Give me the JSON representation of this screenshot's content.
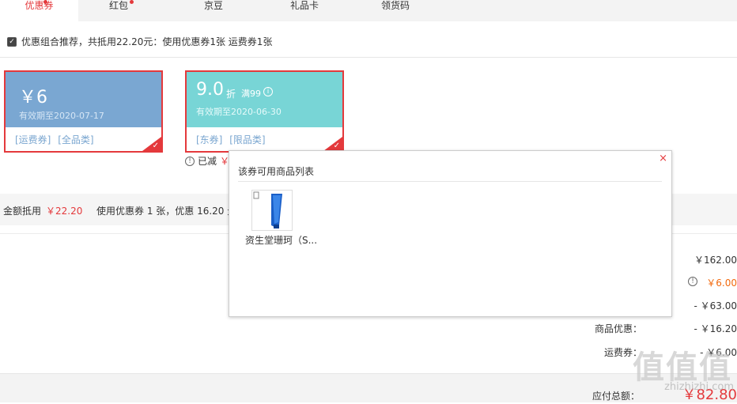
{
  "tabs": [
    {
      "label": "优惠券",
      "active": true,
      "dot": true
    },
    {
      "label": "红包",
      "active": false,
      "dot": true
    },
    {
      "label": "京豆",
      "active": false,
      "dot": false
    },
    {
      "label": "礼品卡",
      "active": false,
      "dot": false
    },
    {
      "label": "领货码",
      "active": false,
      "dot": false
    }
  ],
  "recommend": {
    "checked": true,
    "text": "优惠组合推荐，共抵用22.20元：使用优惠券1张 运费券1张"
  },
  "coupons": [
    {
      "amount": "￥6",
      "expiry": "有效期至2020-07-17",
      "tags": [
        "[运费券]",
        "[全品类]"
      ],
      "color": "#7aa7d2",
      "selected": true
    },
    {
      "amount": "9.0",
      "unit": "折",
      "condition": "满99",
      "expiry": "有效期至2020-06-30",
      "tags": [
        "[东券]",
        "[限品类]"
      ],
      "color": "#78d5d6",
      "selected": true
    }
  ],
  "reduced": {
    "label": "已减",
    "value": "￥"
  },
  "summary_band": {
    "deduct_label": "金额抵用",
    "deduct_value": "￥22.20",
    "usage_text": "使用优惠券 1 张，优惠 16.20 元"
  },
  "totals": [
    {
      "label": "",
      "value": "￥162.00"
    },
    {
      "label": "",
      "value": "￥6.00",
      "info": true
    },
    {
      "label": "",
      "value": "- ￥63.00"
    },
    {
      "label": "商品优惠：",
      "value": "- ￥16.20"
    },
    {
      "label": "运费券：",
      "value": "- ￥6.00"
    }
  ],
  "payable": {
    "label": "应付总额：",
    "value": "￥82.80"
  },
  "popup": {
    "title": "该券可用商品列表",
    "close": "×",
    "product_name": "资生堂珊珂（S..."
  },
  "watermark": {
    "text": "值值值",
    "url": "zhizhizhi.com"
  },
  "colors": {
    "accent": "#e4393c",
    "coupon_blue": "#7aa7d2",
    "coupon_teal": "#78d5d6"
  }
}
